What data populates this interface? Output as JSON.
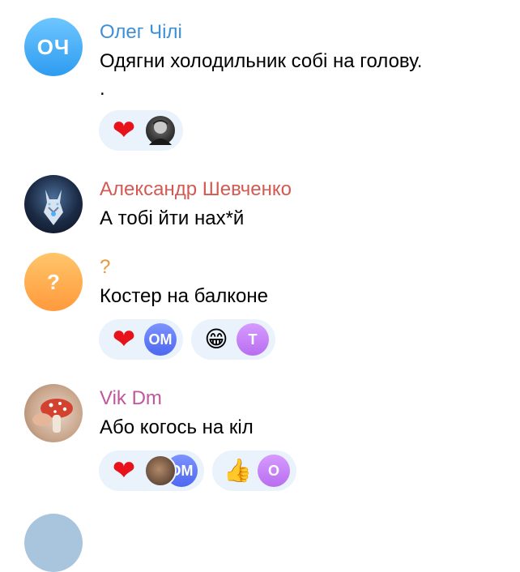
{
  "messages": [
    {
      "sender": "Олег Чілі",
      "avatar_initials": "ОЧ",
      "name_color": "#3f8fd6",
      "text": "Одягни холодильник собі на голову.",
      "text2": ".",
      "reactions": [
        {
          "emoji": "❤",
          "icon": "heart-icon",
          "users": [
            "photo"
          ]
        }
      ]
    },
    {
      "sender": "Александр Шевченко",
      "avatar": "wolf-photo",
      "name_color": "#d35a52",
      "text": "А тобі йти нах*й",
      "reactions": []
    },
    {
      "sender": "?",
      "avatar_initials": "?",
      "name_color": "#e59a3c",
      "text": "Костер на балконе",
      "reactions": [
        {
          "emoji": "❤",
          "icon": "heart-icon",
          "users": [
            "ОМ"
          ]
        },
        {
          "emoji": "😁",
          "icon": "grinning-face-icon",
          "users": [
            "Т"
          ]
        }
      ]
    },
    {
      "sender": "Vik Dm",
      "avatar": "mushroom-photo",
      "name_color": "#c0569b",
      "text": "Або когось на кіл",
      "reactions": [
        {
          "emoji": "❤",
          "icon": "heart-icon",
          "users": [
            "photo",
            "ОМ"
          ]
        },
        {
          "emoji": "👍",
          "icon": "thumbs-up-icon",
          "users": [
            "О"
          ]
        }
      ]
    }
  ]
}
